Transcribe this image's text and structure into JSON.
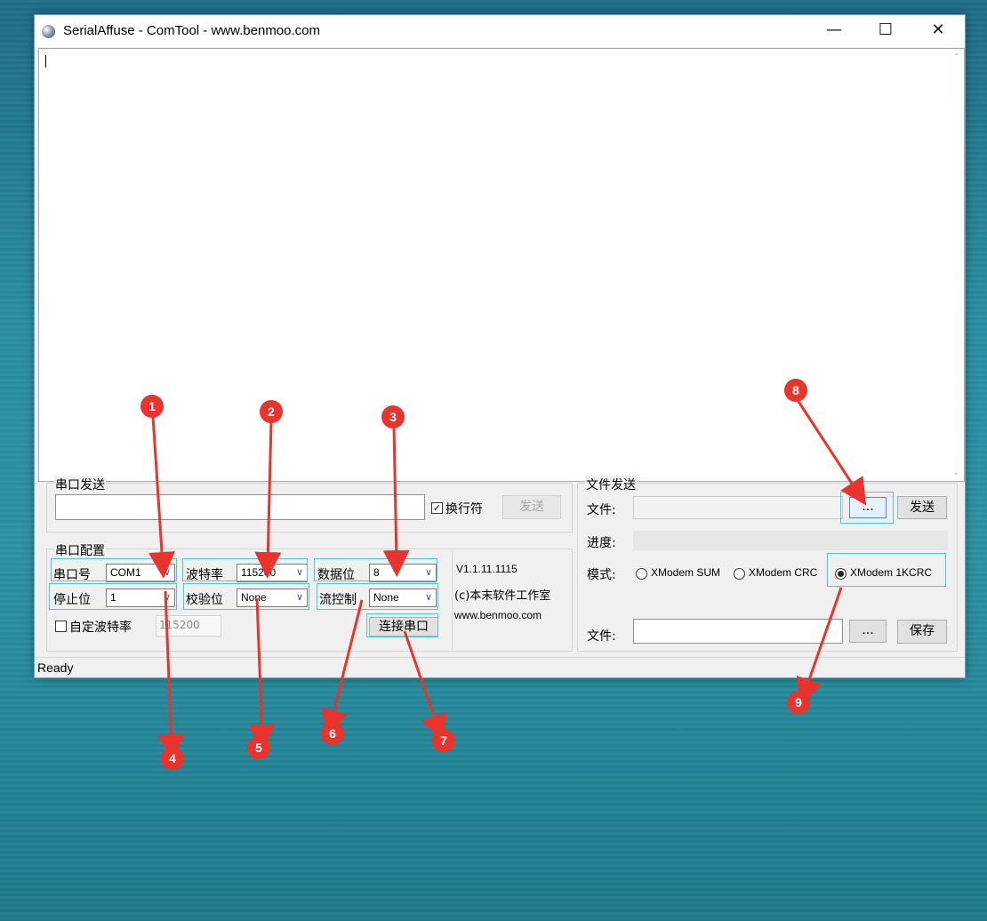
{
  "window": {
    "title": "SerialAffuse - ComTool - www.benmoo.com",
    "minimize": "—",
    "maximize": "☐",
    "close": "✕",
    "status": "Ready"
  },
  "serial_send": {
    "group_label": "串口发送",
    "input_value": "",
    "newline_label": "换行符",
    "newline_checked": "✓",
    "send_button": "发送"
  },
  "serial_config": {
    "group_label": "串口配置",
    "port_label": "串口号",
    "port_value": "COM1",
    "baud_label": "波特率",
    "baud_value": "115200",
    "databits_label": "数据位",
    "databits_value": "8",
    "stopbits_label": "停止位",
    "stopbits_value": "1",
    "parity_label": "校验位",
    "parity_value": "None",
    "flow_label": "流控制",
    "flow_value": "None",
    "custom_baud_label": "自定波特率",
    "custom_baud_value": "115200",
    "connect_button": "连接串口"
  },
  "about": {
    "version": "V1.1.11.1115",
    "copyright": "(c)本末软件工作室",
    "website": "www.benmoo.com"
  },
  "file_send": {
    "group_label": "文件发送",
    "file_label": "文件:",
    "browse_button": "...",
    "send_button": "发送",
    "progress_label": "进度:",
    "progress": 0,
    "mode_label": "模式:",
    "modes": [
      "XModem SUM",
      "XModem CRC",
      "XModem 1KCRC"
    ],
    "selected_mode": "XModem 1KCRC",
    "save_file_label": "文件:",
    "save_browse_button": "...",
    "save_button": "保存"
  },
  "annotations": [
    "1",
    "2",
    "3",
    "4",
    "5",
    "6",
    "7",
    "8",
    "9"
  ],
  "annotation_color": "#e8342c",
  "highlight_color": "#47c9d6"
}
